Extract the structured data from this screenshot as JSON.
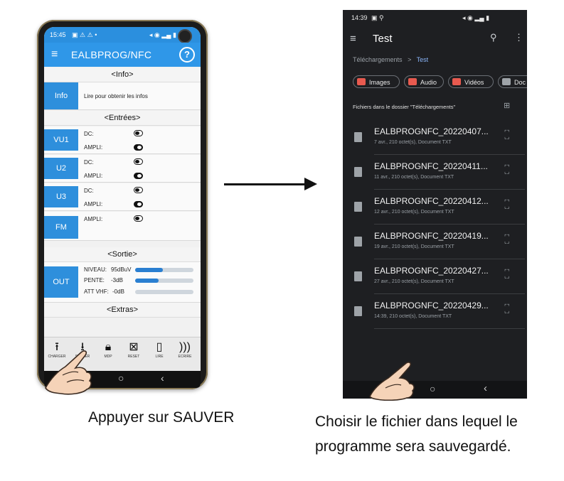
{
  "phone1": {
    "status_time": "15:45",
    "app_title": "EALBPROG/NFC",
    "help_label": "?",
    "info": {
      "header": "<Info>",
      "tab": "Info",
      "text": "Lire pour obtenir les infos"
    },
    "entrees": {
      "header": "<Entrées>",
      "channels": [
        {
          "tab": "VU1",
          "dc_label": "DC:",
          "ampli_label": "AMPLI:",
          "dc": "off",
          "ampli": "on"
        },
        {
          "tab": "U2",
          "dc_label": "DC:",
          "ampli_label": "AMPLI:",
          "dc": "off",
          "ampli": "on"
        },
        {
          "tab": "U3",
          "dc_label": "DC:",
          "ampli_label": "AMPLI:",
          "dc": "off",
          "ampli": "on"
        },
        {
          "tab": "FM",
          "ampli_label": "AMPLI:",
          "ampli": "off"
        }
      ]
    },
    "sortie": {
      "header": "<Sortie>",
      "tab": "OUT",
      "rows": [
        {
          "label": "NIVEAU:",
          "value": "95dBuV",
          "level": 0.48
        },
        {
          "label": "PENTE:",
          "value": "-3dB",
          "level": 0.4
        },
        {
          "label": "ATT VHF:",
          "value": "-0dB",
          "level": 0.0
        }
      ]
    },
    "extras": {
      "header": "<Extras>"
    },
    "bottom_buttons": [
      {
        "label": "CHARGER",
        "icon": "upload-icon"
      },
      {
        "label": "SAUVER",
        "icon": "download-icon"
      },
      {
        "label": "MDP",
        "icon": "lock-icon"
      },
      {
        "label": "RESET",
        "icon": "reset-icon"
      },
      {
        "label": "LIRE",
        "icon": "nfc-read-icon"
      },
      {
        "label": "ECRIRE",
        "icon": "nfc-write-icon"
      }
    ]
  },
  "phone2": {
    "status_time": "14:39",
    "title": "Test",
    "breadcrumb": {
      "parent": "Téléchargements",
      "separator": ">",
      "current": "Test"
    },
    "chips": [
      {
        "label": "Images",
        "color": "#e85a4f"
      },
      {
        "label": "Audio",
        "color": "#e85a4f"
      },
      {
        "label": "Vidéos",
        "color": "#e85a4f"
      },
      {
        "label": "Doc",
        "color": "#9ea3a8"
      }
    ],
    "folder_label": "Fichiers dans le dossier \"Téléchargements\"",
    "files": [
      {
        "name": "EALBPROGNFC_20220407...",
        "meta": "7 avr., 210 octet(s), Document TXT"
      },
      {
        "name": "EALBPROGNFC_20220411...",
        "meta": "11 avr., 210 octet(s), Document TXT"
      },
      {
        "name": "EALBPROGNFC_20220412...",
        "meta": "12 avr., 210 octet(s), Document TXT"
      },
      {
        "name": "EALBPROGNFC_20220419...",
        "meta": "19 avr., 210 octet(s), Document TXT"
      },
      {
        "name": "EALBPROGNFC_20220427...",
        "meta": "27 avr., 210 octet(s), Document TXT"
      },
      {
        "name": "EALBPROGNFC_20220429...",
        "meta": "14:39, 210 octet(s), Document TXT"
      }
    ]
  },
  "captions": {
    "left": "Appuyer sur SAUVER",
    "right": "Choisir le fichier dans lequel le programme sera sauvegardé."
  },
  "colors": {
    "accent": "#2f97e8",
    "dark_bg": "#1e1f22"
  }
}
